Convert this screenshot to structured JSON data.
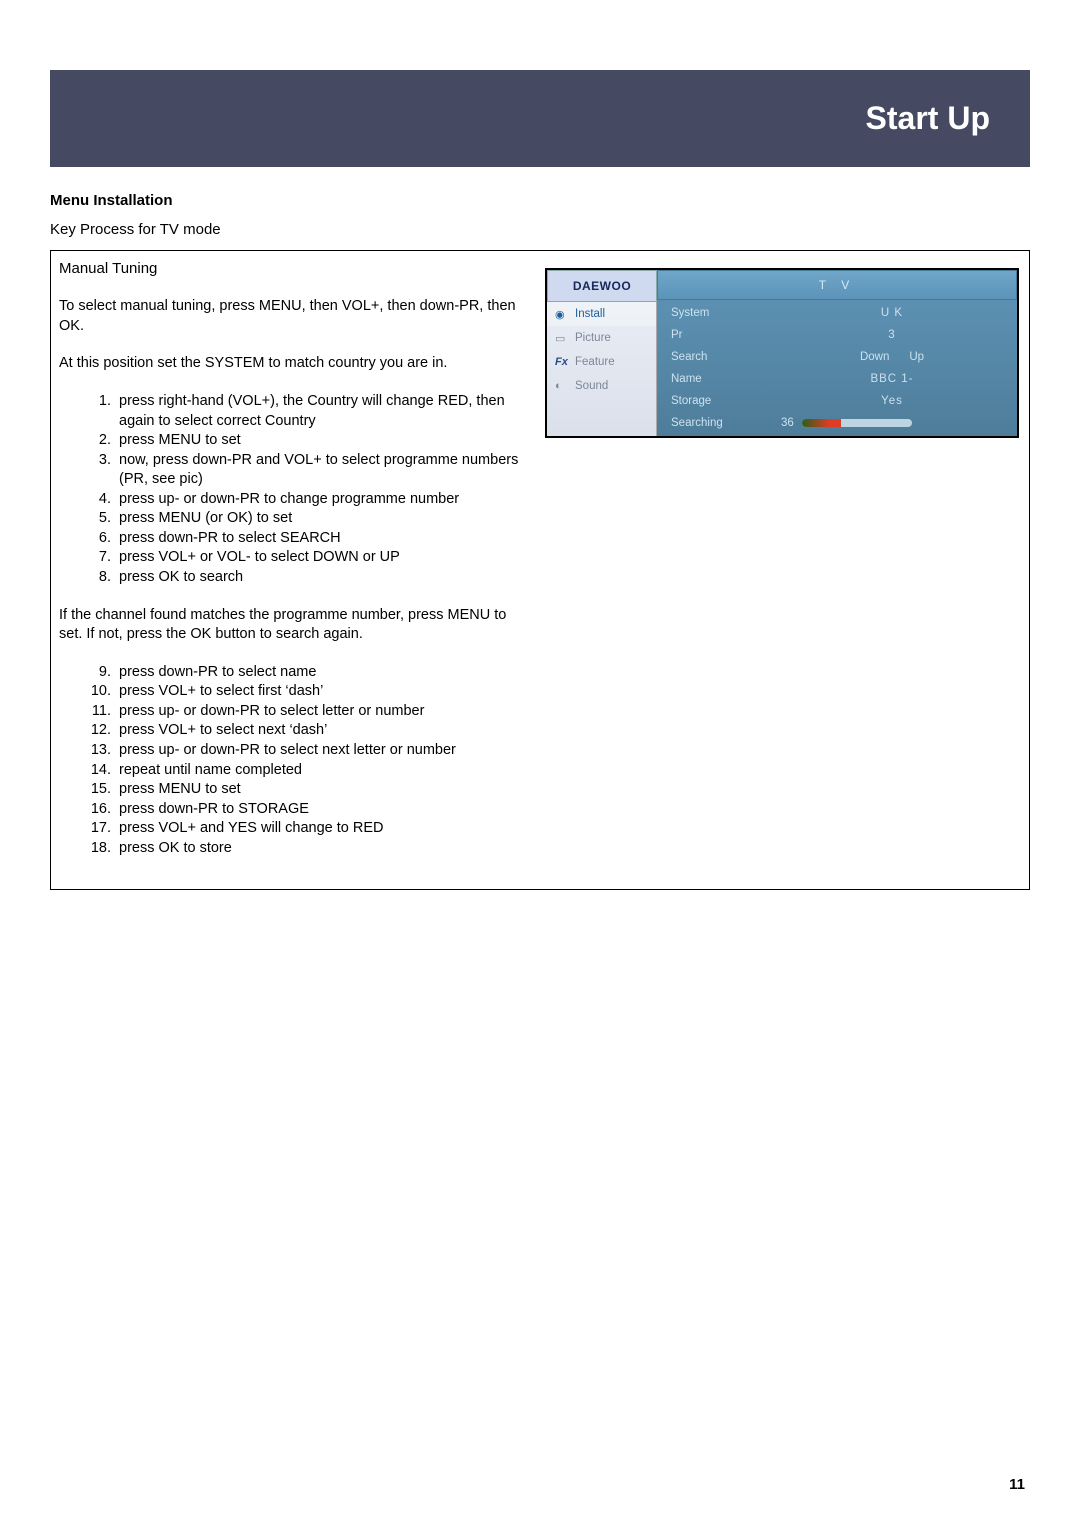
{
  "header": {
    "title": "Start Up"
  },
  "section": {
    "heading": "Menu Installation",
    "subheading": "Key Process for TV mode"
  },
  "manual": {
    "title": "Manual Tuning",
    "intro1": "To select manual tuning, press MENU, then VOL+, then down-PR, then OK.",
    "intro2": "At this position set the SYSTEM to match country you are in.",
    "steps_a": [
      "press right-hand (VOL+), the Country will change RED, then again to select correct Country",
      "press MENU to set",
      "now, press down-PR and VOL+ to select programme numbers (PR, see pic)",
      "press up- or down-PR to change programme number",
      "press MENU (or OK) to set",
      "press down-PR to select SEARCH",
      "press VOL+ or VOL- to select DOWN or UP",
      "press OK to search"
    ],
    "mid": "If the channel found matches the programme number, press MENU to set. If not, press the OK button to search again.",
    "steps_b": [
      "press down-PR to select name",
      "press VOL+ to select first ‘dash’",
      "press up- or down-PR to select letter or number",
      "press VOL+ to select next ‘dash’",
      "press up- or down-PR to select next letter or number",
      "repeat until name completed",
      "press MENU to set",
      "press down-PR to STORAGE",
      "press VOL+ and YES will change to RED",
      "press OK to store"
    ]
  },
  "osd": {
    "brand": "DAEWOO",
    "top_tab": "T V",
    "menu": [
      {
        "icon": "◉",
        "label": "Install",
        "selected": true
      },
      {
        "icon": "▭",
        "label": "Picture",
        "selected": false
      },
      {
        "icon": "Fx",
        "label": "Feature",
        "selected": false
      },
      {
        "icon": "◐",
        "label": "Sound",
        "selected": false
      }
    ],
    "rows": {
      "system": {
        "label": "System",
        "value": "U K"
      },
      "pr": {
        "label": "Pr",
        "value": "3"
      },
      "search": {
        "label": "Search",
        "down": "Down",
        "up": "Up"
      },
      "name": {
        "label": "Name",
        "value": "BBC 1-"
      },
      "storage": {
        "label": "Storage",
        "value": "Yes"
      },
      "searching": {
        "label": "Searching",
        "value": "36"
      }
    }
  },
  "page_number": "11"
}
